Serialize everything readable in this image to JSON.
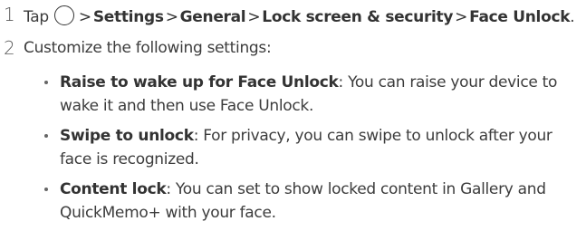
{
  "steps": [
    {
      "number": "1",
      "text_tap": "Tap",
      "separator": ">",
      "path": [
        "Settings",
        "General",
        "Lock screen & security",
        "Face Unlock"
      ],
      "end": "."
    },
    {
      "number": "2",
      "text": "Customize the following settings:"
    }
  ],
  "settings": [
    {
      "name": "Raise to wake up for Face Unlock",
      "desc": ": You can raise your device to wake it and then use Face Unlock."
    },
    {
      "name": "Swipe to unlock",
      "desc": ": For privacy, you can swipe to unlock after your face is recognized."
    },
    {
      "name": "Content lock",
      "desc": ": You can set to show locked content in Gallery and QuickMemo+ with your face."
    }
  ],
  "icons": {
    "home": "home-circle-icon"
  }
}
